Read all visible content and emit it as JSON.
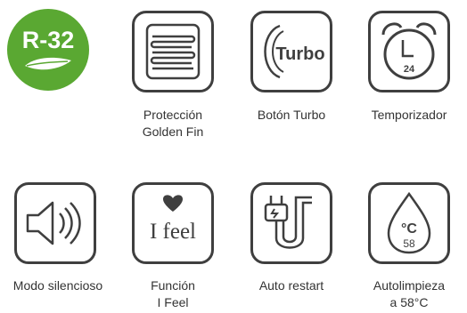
{
  "badge": {
    "text": "R-32",
    "color": "#5aa832"
  },
  "features": [
    {
      "icon": "golden-fin-icon",
      "lines": [
        "Protección",
        "Golden Fin"
      ]
    },
    {
      "icon": "turbo-icon",
      "icon_text": "Turbo",
      "lines": [
        "Botón Turbo"
      ]
    },
    {
      "icon": "alarm-clock-icon",
      "icon_text": "24",
      "lines": [
        "Temporizador"
      ]
    },
    {
      "icon": "speaker-icon",
      "lines": [
        "Modo silencioso"
      ]
    },
    {
      "icon": "heart-icon",
      "icon_text": "I feel",
      "lines": [
        "Función",
        "I Feel"
      ]
    },
    {
      "icon": "plug-icon",
      "lines": [
        "Auto restart"
      ]
    },
    {
      "icon": "water-drop-icon",
      "icon_text_1": "°C",
      "icon_text_2": "58",
      "lines": [
        "Autolimpieza",
        "a 58°C"
      ]
    }
  ]
}
